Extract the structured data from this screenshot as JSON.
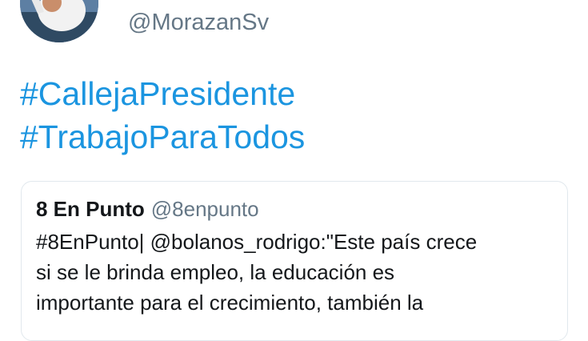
{
  "tweet": {
    "avatar_icon": "profile-photo",
    "handle": "@MorazanSv",
    "hashtags": [
      "#CallejaPresidente",
      "#TrabajoParaTodos"
    ],
    "link_color": "#1b95e0"
  },
  "quoted_tweet": {
    "name": "8 En Punto",
    "handle": "@8enpunto",
    "text_lines": [
      "#8EnPunto| @bolanos_rodrigo:\"Este país crece",
      "si se le brinda empleo, la educación es",
      "importante para el crecimiento, también la"
    ]
  }
}
